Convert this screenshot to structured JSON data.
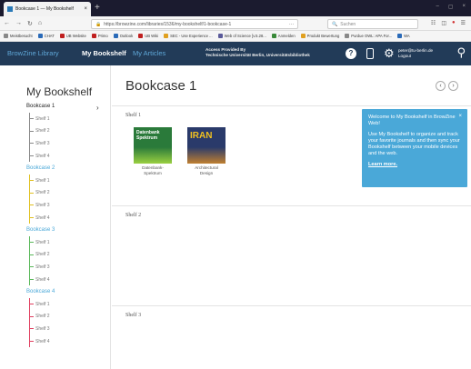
{
  "browser": {
    "tab_title": "Bookcase 1 — My Bookshelf",
    "tab_close": "×",
    "new_tab": "+",
    "window_controls": [
      "–",
      "▢",
      "×"
    ],
    "url": "https://browzine.com/libraries/1536/my-bookshelf/1-bookcase-1",
    "url_more": "···",
    "search_placeholder": "Suchen",
    "bookmarks": [
      {
        "label": "Meistbesucht",
        "color": "#888888"
      },
      {
        "label": "CHAT",
        "color": "#2a6ab8"
      },
      {
        "label": "UB Website",
        "color": "#c02020"
      },
      {
        "label": "Primo",
        "color": "#c02020"
      },
      {
        "label": "Outlook",
        "color": "#2a6ab8"
      },
      {
        "label": "UB Wiki",
        "color": "#c02020"
      },
      {
        "label": "SEC - Use Experience ...",
        "color": "#e0a020"
      },
      {
        "label": "Web of Science [v.5.28...",
        "color": "#5a5a9a"
      },
      {
        "label": "Anmelden",
        "color": "#3a8a3a"
      },
      {
        "label": "Produkt Bewertung",
        "color": "#e0a020"
      },
      {
        "label": "Purdue OWL: APA For...",
        "color": "#888888"
      },
      {
        "label": "WA",
        "color": "#2a6ab8"
      }
    ]
  },
  "app": {
    "logo": "BrowZine Library",
    "nav_bookshelf": "My Bookshelf",
    "nav_articles": "My Articles",
    "access_line1": "Access Provided By",
    "access_line2": "Technische Universität Berlin, Universitätsbibliothek",
    "help": "?",
    "user_email": "peter@tu-berlin.de",
    "user_logout": "Logout"
  },
  "sidebar": {
    "title": "My Bookshelf",
    "bookcases": [
      {
        "label": "Bookcase 1",
        "color": "#222222",
        "line": "#888888",
        "shelves": [
          "Shelf 1",
          "Shelf 2",
          "Shelf 3",
          "Shelf 4"
        ]
      },
      {
        "label": "Bookcase 2",
        "color": "#4aa8d8",
        "line": "#e0c020",
        "shelves": [
          "Shelf 1",
          "Shelf 2",
          "Shelf 3",
          "Shelf 4"
        ]
      },
      {
        "label": "Bookcase 3",
        "color": "#4aa8d8",
        "line": "#5ab85a",
        "shelves": [
          "Shelf 1",
          "Shelf 2",
          "Shelf 3",
          "Shelf 4"
        ]
      },
      {
        "label": "Bookcase 4",
        "color": "#4aa8d8",
        "line": "#e04060",
        "shelves": [
          "Shelf 1",
          "Shelf 2",
          "Shelf 3",
          "Shelf 4"
        ]
      }
    ]
  },
  "main": {
    "title": "Bookcase 1",
    "prev": "‹",
    "next": "›",
    "shelves": [
      {
        "label": "Shelf 1",
        "books": [
          {
            "title_line1": "Datenbank-",
            "title_line2": "Spektrum",
            "cover_text": "Datenbank Spektrum"
          },
          {
            "title_line1": "Architectural",
            "title_line2": "Design",
            "cover_text": "IRAN"
          }
        ]
      },
      {
        "label": "Shelf 2",
        "books": []
      },
      {
        "label": "Shelf 3",
        "books": []
      }
    ]
  },
  "popup": {
    "close": "×",
    "heading": "Welcome to My Bookshelf in BrowZine Web!",
    "body": "Use My Bookshelf to organize and track your favorite journals and then sync your Bookshelf between your mobile devices and the web.",
    "link": "Learn more."
  }
}
